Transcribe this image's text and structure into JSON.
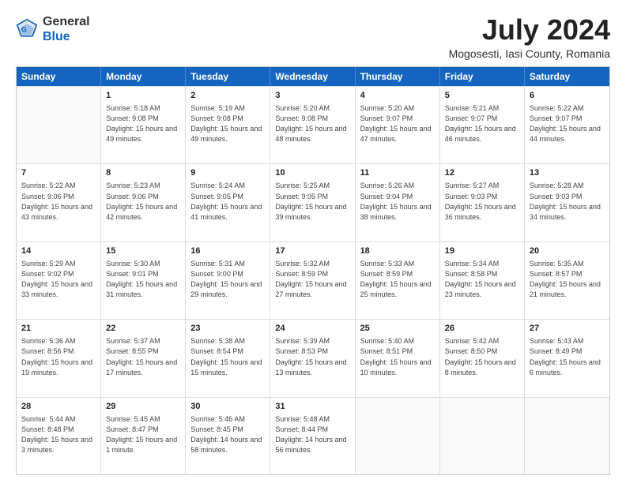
{
  "header": {
    "logo_general": "General",
    "logo_blue": "Blue",
    "month_year": "July 2024",
    "location": "Mogosesti, Iasi County, Romania"
  },
  "days_of_week": [
    "Sunday",
    "Monday",
    "Tuesday",
    "Wednesday",
    "Thursday",
    "Friday",
    "Saturday"
  ],
  "weeks": [
    [
      {
        "day": "",
        "empty": true
      },
      {
        "day": "1",
        "sunrise": "5:18 AM",
        "sunset": "9:08 PM",
        "daylight": "15 hours and 49 minutes."
      },
      {
        "day": "2",
        "sunrise": "5:19 AM",
        "sunset": "9:08 PM",
        "daylight": "15 hours and 49 minutes."
      },
      {
        "day": "3",
        "sunrise": "5:20 AM",
        "sunset": "9:08 PM",
        "daylight": "15 hours and 48 minutes."
      },
      {
        "day": "4",
        "sunrise": "5:20 AM",
        "sunset": "9:07 PM",
        "daylight": "15 hours and 47 minutes."
      },
      {
        "day": "5",
        "sunrise": "5:21 AM",
        "sunset": "9:07 PM",
        "daylight": "15 hours and 46 minutes."
      },
      {
        "day": "6",
        "sunrise": "5:22 AM",
        "sunset": "9:07 PM",
        "daylight": "15 hours and 44 minutes."
      }
    ],
    [
      {
        "day": "7",
        "sunrise": "5:22 AM",
        "sunset": "9:06 PM",
        "daylight": "15 hours and 43 minutes."
      },
      {
        "day": "8",
        "sunrise": "5:23 AM",
        "sunset": "9:06 PM",
        "daylight": "15 hours and 42 minutes."
      },
      {
        "day": "9",
        "sunrise": "5:24 AM",
        "sunset": "9:05 PM",
        "daylight": "15 hours and 41 minutes."
      },
      {
        "day": "10",
        "sunrise": "5:25 AM",
        "sunset": "9:05 PM",
        "daylight": "15 hours and 39 minutes."
      },
      {
        "day": "11",
        "sunrise": "5:26 AM",
        "sunset": "9:04 PM",
        "daylight": "15 hours and 38 minutes."
      },
      {
        "day": "12",
        "sunrise": "5:27 AM",
        "sunset": "9:03 PM",
        "daylight": "15 hours and 36 minutes."
      },
      {
        "day": "13",
        "sunrise": "5:28 AM",
        "sunset": "9:03 PM",
        "daylight": "15 hours and 34 minutes."
      }
    ],
    [
      {
        "day": "14",
        "sunrise": "5:29 AM",
        "sunset": "9:02 PM",
        "daylight": "15 hours and 33 minutes."
      },
      {
        "day": "15",
        "sunrise": "5:30 AM",
        "sunset": "9:01 PM",
        "daylight": "15 hours and 31 minutes."
      },
      {
        "day": "16",
        "sunrise": "5:31 AM",
        "sunset": "9:00 PM",
        "daylight": "15 hours and 29 minutes."
      },
      {
        "day": "17",
        "sunrise": "5:32 AM",
        "sunset": "8:59 PM",
        "daylight": "15 hours and 27 minutes."
      },
      {
        "day": "18",
        "sunrise": "5:33 AM",
        "sunset": "8:59 PM",
        "daylight": "15 hours and 25 minutes."
      },
      {
        "day": "19",
        "sunrise": "5:34 AM",
        "sunset": "8:58 PM",
        "daylight": "15 hours and 23 minutes."
      },
      {
        "day": "20",
        "sunrise": "5:35 AM",
        "sunset": "8:57 PM",
        "daylight": "15 hours and 21 minutes."
      }
    ],
    [
      {
        "day": "21",
        "sunrise": "5:36 AM",
        "sunset": "8:56 PM",
        "daylight": "15 hours and 19 minutes."
      },
      {
        "day": "22",
        "sunrise": "5:37 AM",
        "sunset": "8:55 PM",
        "daylight": "15 hours and 17 minutes."
      },
      {
        "day": "23",
        "sunrise": "5:38 AM",
        "sunset": "8:54 PM",
        "daylight": "15 hours and 15 minutes."
      },
      {
        "day": "24",
        "sunrise": "5:39 AM",
        "sunset": "8:53 PM",
        "daylight": "15 hours and 13 minutes."
      },
      {
        "day": "25",
        "sunrise": "5:40 AM",
        "sunset": "8:51 PM",
        "daylight": "15 hours and 10 minutes."
      },
      {
        "day": "26",
        "sunrise": "5:42 AM",
        "sunset": "8:50 PM",
        "daylight": "15 hours and 8 minutes."
      },
      {
        "day": "27",
        "sunrise": "5:43 AM",
        "sunset": "8:49 PM",
        "daylight": "15 hours and 6 minutes."
      }
    ],
    [
      {
        "day": "28",
        "sunrise": "5:44 AM",
        "sunset": "8:48 PM",
        "daylight": "15 hours and 3 minutes."
      },
      {
        "day": "29",
        "sunrise": "5:45 AM",
        "sunset": "8:47 PM",
        "daylight": "15 hours and 1 minute."
      },
      {
        "day": "30",
        "sunrise": "5:46 AM",
        "sunset": "8:45 PM",
        "daylight": "14 hours and 58 minutes."
      },
      {
        "day": "31",
        "sunrise": "5:48 AM",
        "sunset": "8:44 PM",
        "daylight": "14 hours and 56 minutes."
      },
      {
        "day": "",
        "empty": true
      },
      {
        "day": "",
        "empty": true
      },
      {
        "day": "",
        "empty": true
      }
    ]
  ]
}
